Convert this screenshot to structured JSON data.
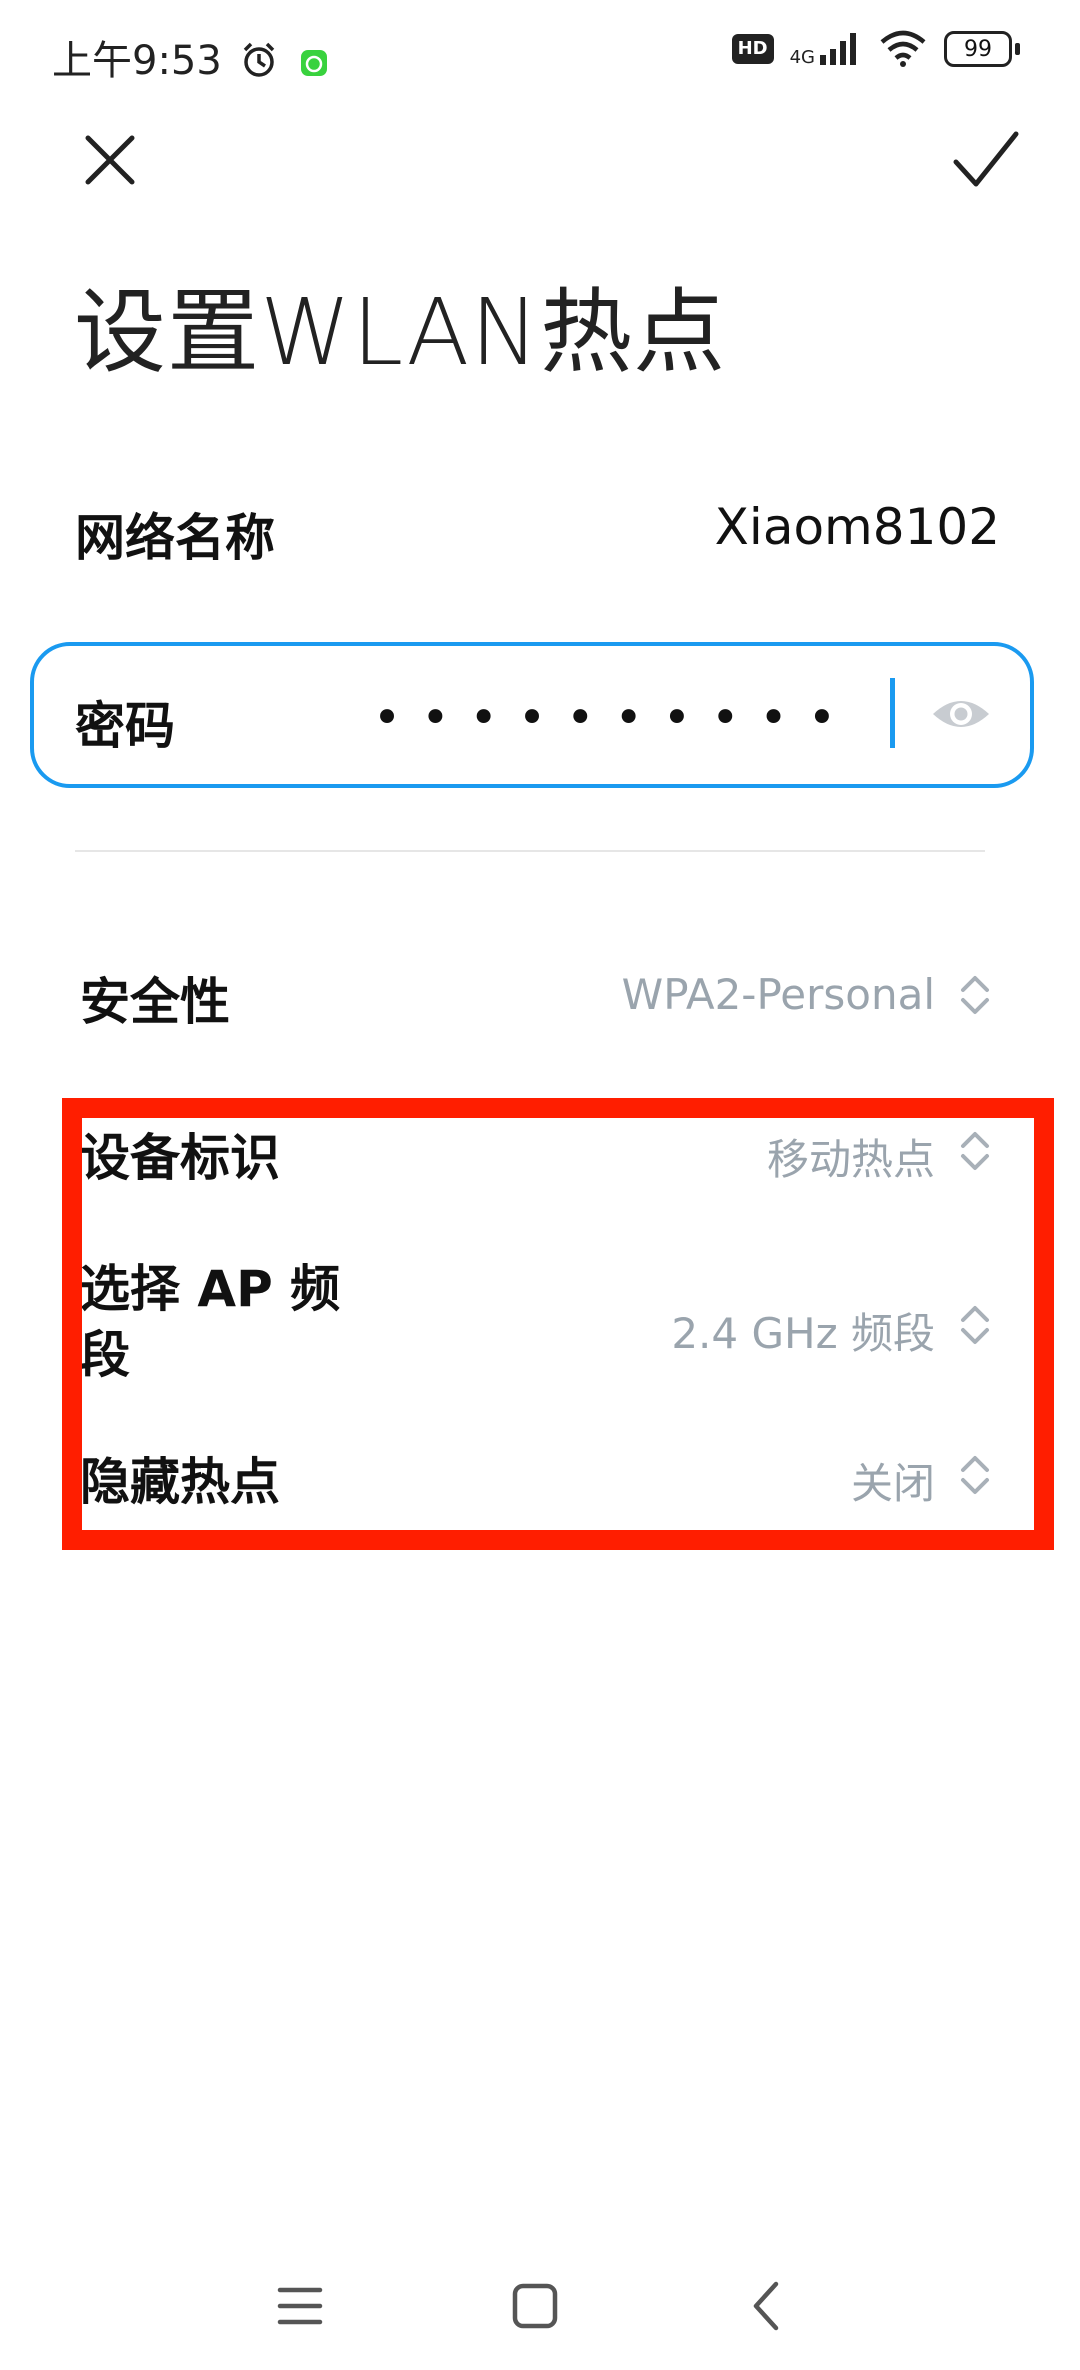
{
  "status_bar": {
    "time": "上午9:53",
    "hd": "HD",
    "network": "4G",
    "battery": "99"
  },
  "header": {
    "title": "设置WLAN热点"
  },
  "network_name": {
    "label": "网络名称",
    "value": "Xiaom8102"
  },
  "password": {
    "label": "密码",
    "masked_value": "••••••••••"
  },
  "security": {
    "label": "安全性",
    "value": "WPA2-Personal"
  },
  "device_id": {
    "label": "设备标识",
    "value": "移动热点"
  },
  "ap_band": {
    "label_line1": "选择 AP 频",
    "label_line2": "段",
    "value": "2.4 GHz 频段"
  },
  "hidden_hotspot": {
    "label": "隐藏热点",
    "value": "关闭"
  },
  "colors": {
    "accent": "#1a9af0",
    "highlight": "#ff1e00",
    "muted": "#9aa4ad"
  }
}
